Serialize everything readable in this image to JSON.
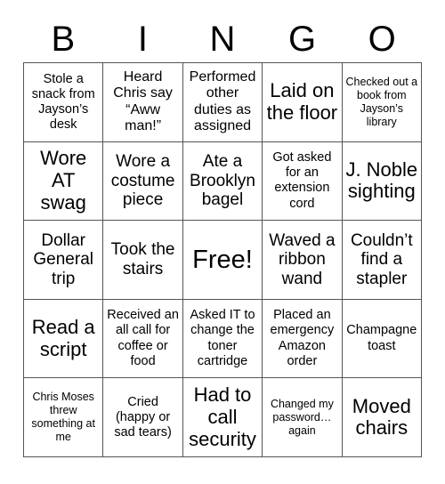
{
  "card": {
    "header_letters": [
      "B",
      "I",
      "N",
      "G",
      "O"
    ],
    "grid": {
      "columns": 5,
      "rows": 5,
      "border_color": "#555555",
      "background_color": "#ffffff",
      "text_color": "#000000"
    },
    "squares": [
      {
        "id": "b1",
        "text": "Stole a snack from Jayson’s desk",
        "size": "sm"
      },
      {
        "id": "i1",
        "text": "Heard Chris say “Aww man!”",
        "size": "md"
      },
      {
        "id": "n1",
        "text": "Performed other duties as assigned",
        "size": "md"
      },
      {
        "id": "g1",
        "text": "Laid on the floor",
        "size": "xl"
      },
      {
        "id": "o1",
        "text": "Checked out a book from Jayson’s library",
        "size": "xs"
      },
      {
        "id": "b2",
        "text": "Wore AT swag",
        "size": "xl"
      },
      {
        "id": "i2",
        "text": "Wore a costume piece",
        "size": "lg"
      },
      {
        "id": "n2",
        "text": "Ate a Brooklyn bagel",
        "size": "lg"
      },
      {
        "id": "g2",
        "text": "Got asked for an extension cord",
        "size": "sm"
      },
      {
        "id": "o2",
        "text": "J. Noble sighting",
        "size": "xl"
      },
      {
        "id": "b3",
        "text": "Dollar General trip",
        "size": "lg"
      },
      {
        "id": "i3",
        "text": "Took the stairs",
        "size": "lg"
      },
      {
        "id": "n3",
        "text": "Free!",
        "size": "free"
      },
      {
        "id": "g3",
        "text": "Waved a ribbon wand",
        "size": "lg"
      },
      {
        "id": "o3",
        "text": "Couldn’t find a stapler",
        "size": "lg"
      },
      {
        "id": "b4",
        "text": "Read a script",
        "size": "xl"
      },
      {
        "id": "i4",
        "text": "Received an all call for coffee or food",
        "size": "sm"
      },
      {
        "id": "n4",
        "text": "Asked IT to change the toner cartridge",
        "size": "sm"
      },
      {
        "id": "g4",
        "text": "Placed an emergency Amazon order",
        "size": "sm"
      },
      {
        "id": "o4",
        "text": "Champagne toast",
        "size": "sm"
      },
      {
        "id": "b5",
        "text": "Chris Moses threw something at me",
        "size": "xs"
      },
      {
        "id": "i5",
        "text": "Cried (happy or sad tears)",
        "size": "sm"
      },
      {
        "id": "n5",
        "text": "Had to call security",
        "size": "xl"
      },
      {
        "id": "g5",
        "text": "Changed my password… again",
        "size": "xs"
      },
      {
        "id": "o5",
        "text": "Moved chairs",
        "size": "xl"
      }
    ]
  }
}
